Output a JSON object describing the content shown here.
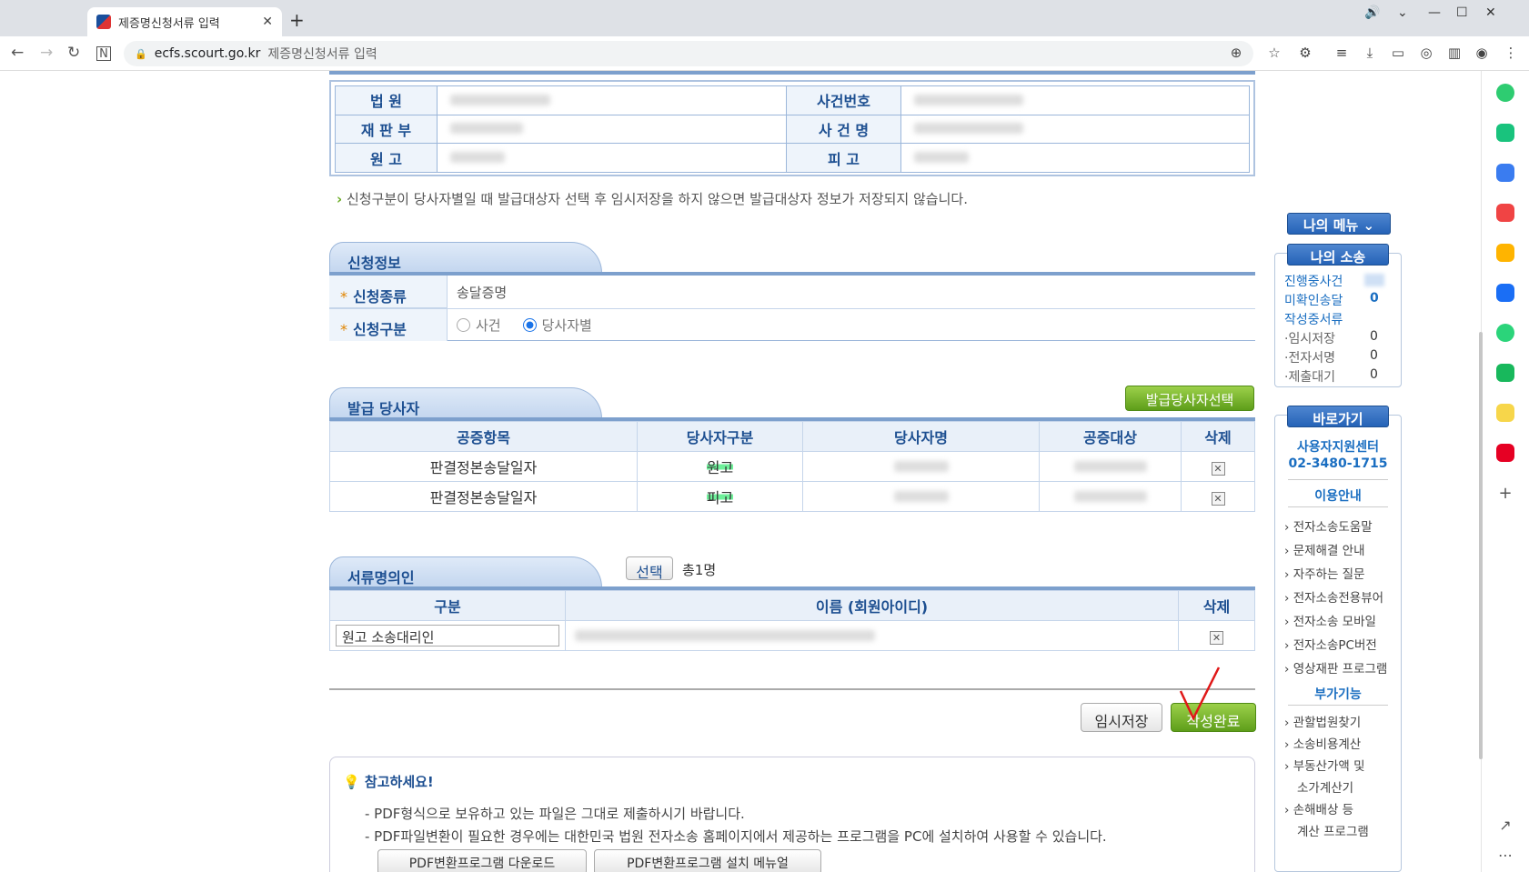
{
  "browser": {
    "tab_title": "제증명신청서류 입력",
    "new_tab": "+",
    "url_host": "ecfs.scourt.go.kr",
    "url_title": "제증명신청서류 입력"
  },
  "case_info": {
    "rows": [
      {
        "l1": "법 원",
        "l2": "사건번호"
      },
      {
        "l1": "재 판 부",
        "l2": "사 건 명"
      },
      {
        "l1": "원 고",
        "l2": "피 고"
      }
    ],
    "notice": "신청구분이 당사자별일 때 발급대상자 선택 후 임시저장을 하지 않으면 발급대상자 정보가 저장되지 않습니다."
  },
  "application": {
    "title": "신청정보",
    "type_label": "신청종류",
    "type_value": "송달증명",
    "category_label": "신청구분",
    "opt_case": "사건",
    "opt_party": "당사자별"
  },
  "parties": {
    "title": "발급 당사자",
    "select_button": "발급당사자선택",
    "headers": [
      "공증항목",
      "당사자구분",
      "당사자명",
      "공증대상",
      "삭제"
    ],
    "rows": [
      {
        "item": "판결정본송달일자",
        "kind": "원고"
      },
      {
        "item": "판결정본송달일자",
        "kind": "피고"
      }
    ]
  },
  "signers": {
    "title": "서류명의인",
    "select_button": "선택",
    "count": "총1명",
    "headers": [
      "구분",
      "이름 (회원아이디)",
      "삭제"
    ],
    "row_value": "원고 소송대리인"
  },
  "actions": {
    "temp_save": "임시저장",
    "complete": "작성완료"
  },
  "notes": {
    "title": "참고하세요!",
    "line1": "- PDF형식으로 보유하고 있는 파일은 그대로 제출하시기 바랍니다.",
    "line2": "- PDF파일변환이 필요한 경우에는 대한민국 법원 전자소송 홈페이지에서 제공하는 프로그램을 PC에 설치하여 사용할 수 있습니다.",
    "btn1": "PDF변환프로그램 다운로드",
    "btn2": "PDF변환프로그램 설치 메뉴얼"
  },
  "right_menu": {
    "my_menu": "나의 메뉴",
    "my_case": "나의 소송",
    "in_progress": "진행중사건",
    "unconfirmed": "미확인송달",
    "unconfirmed_count": "0",
    "drafting": "작성중서류",
    "temp": "·임시저장",
    "temp_count": "0",
    "esign": "·전자서명",
    "esign_count": "0",
    "submit_wait": "·제출대기",
    "submit_wait_count": "0",
    "shortcut": "바로가기",
    "support": "사용자지원센터",
    "phone": "02-3480-1715",
    "guide_title": "이용안내",
    "guide": [
      "전자소송도움말",
      "문제해결 안내",
      "자주하는 질문",
      "전자소송전용뷰어",
      "전자소송 모바일",
      "전자소송PC버전",
      "영상재판 프로그램"
    ],
    "extra_title": "부가기능",
    "extra": [
      "관할법원찾기",
      "소송비용계산",
      "부동산가액 및",
      "소가계산기",
      "손해배상 등",
      "계산 프로그램"
    ]
  },
  "colors": {
    "accent": "#1d4f91",
    "green": "#6aac24"
  }
}
